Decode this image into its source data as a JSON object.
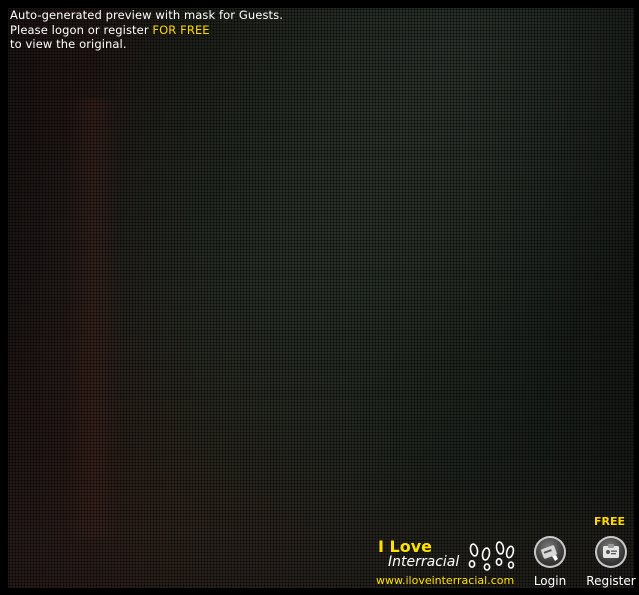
{
  "notice": {
    "line1": "Auto-generated preview with mask for Guests.",
    "line2_prefix": "Please logon or register ",
    "line2_link": "FOR FREE",
    "line3": "to view the original."
  },
  "brand": {
    "line1": "I Love",
    "line2": "Interracial",
    "url": "www.iloveinterracial.com",
    "icon": "footprints-icon"
  },
  "actions": {
    "login": {
      "label": "Login",
      "icon": "login-card-icon"
    },
    "register": {
      "label": "Register",
      "badge": "FREE",
      "icon": "register-id-card-icon"
    }
  },
  "colors": {
    "accent": "#ffd800",
    "text": "#ffffff",
    "background": "#000000"
  }
}
